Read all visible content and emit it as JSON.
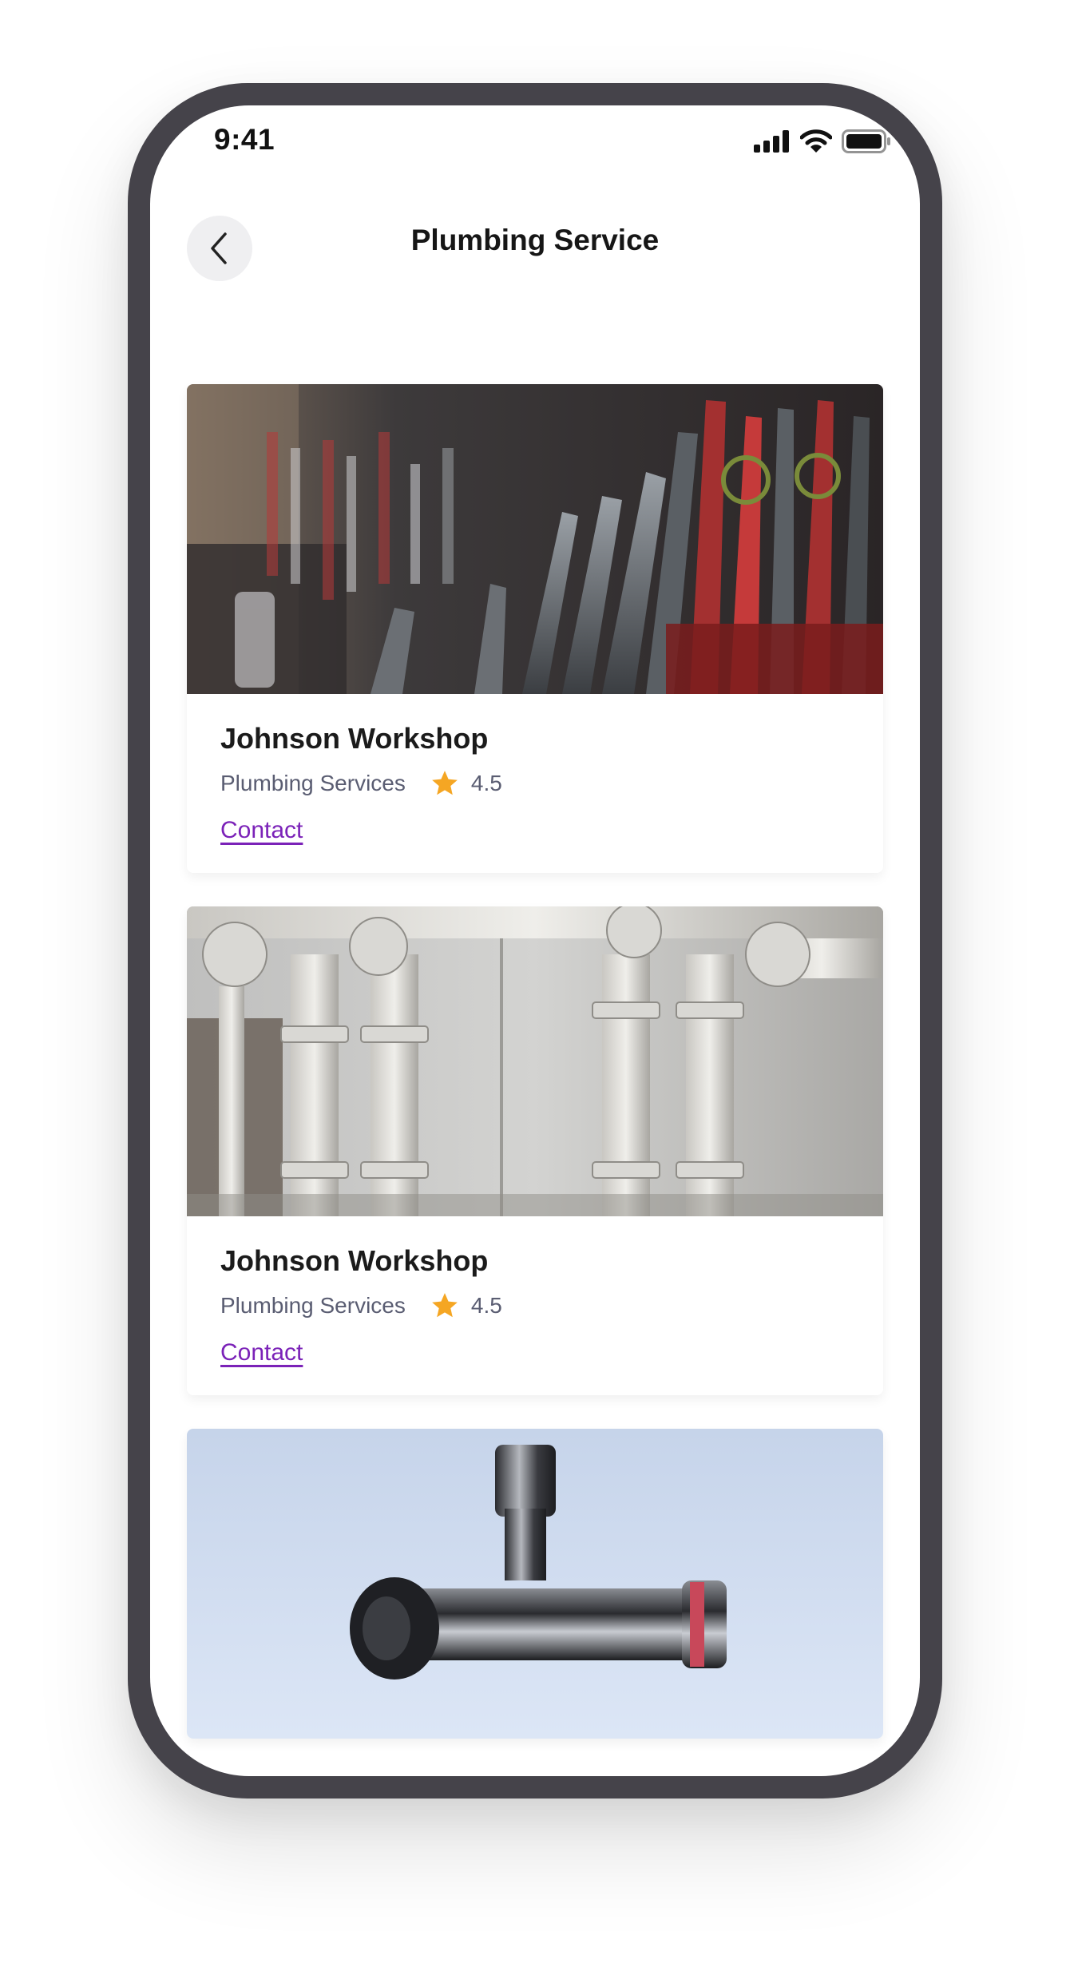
{
  "status_bar": {
    "time": "9:41"
  },
  "header": {
    "title": "Plumbing Service",
    "back_icon": "chevron-left-icon"
  },
  "cards": [
    {
      "title": "Johnson Workshop",
      "category": "Plumbing Services",
      "rating": "4.5",
      "link_label": "Contact",
      "image": "tools-wall-photo"
    },
    {
      "title": "Johnson Workshop",
      "category": "Plumbing Services",
      "rating": "4.5",
      "link_label": "Contact",
      "image": "industrial-pipes-photo"
    },
    {
      "image": "angle-valve-photo"
    }
  ],
  "colors": {
    "frame": "#45434a",
    "accent_link": "#7b22b8",
    "star": "#f5a623",
    "meta_text": "#5a5d72"
  }
}
